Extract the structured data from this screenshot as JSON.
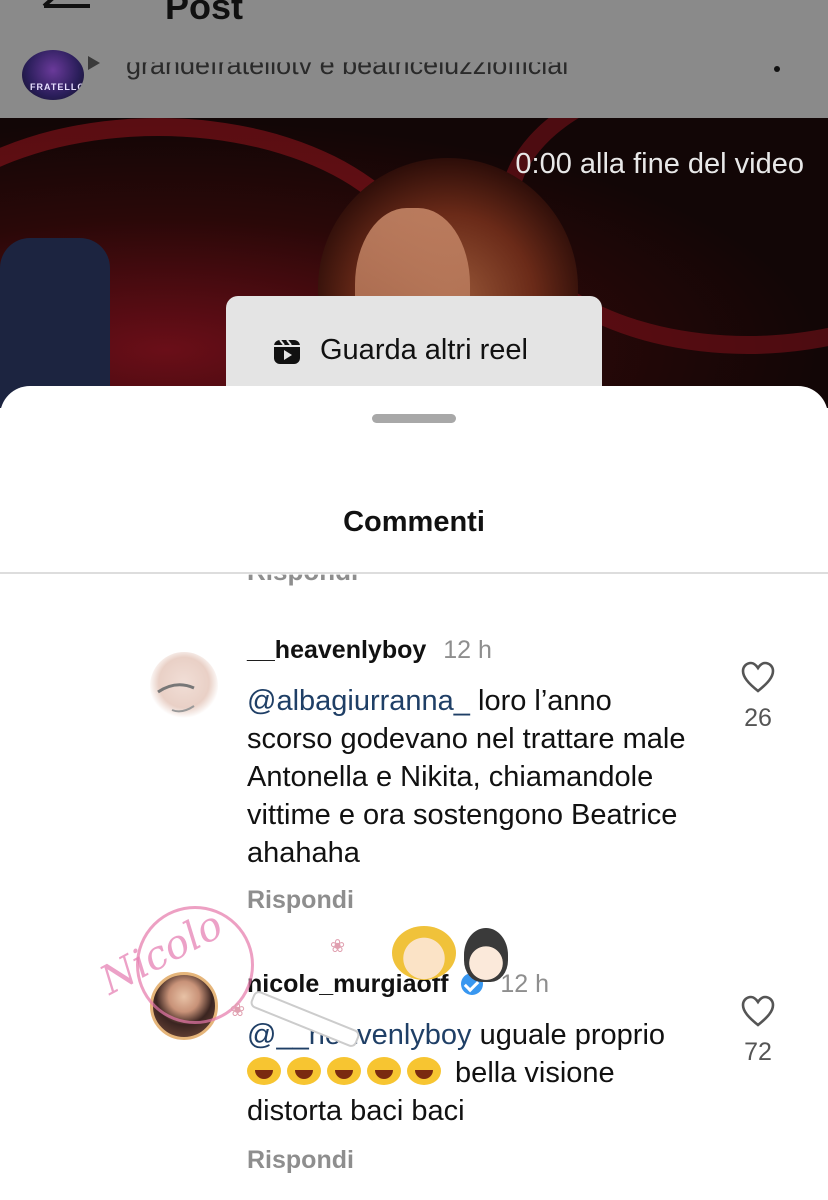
{
  "header": {
    "title": "Post",
    "author_line": "grandefratellotv e beatriceluzziofficial",
    "avatar_text": "FRATELLO"
  },
  "video": {
    "timer": "0:00 alla fine del video",
    "reels_button": "Guarda altri reel"
  },
  "sheet": {
    "title": "Commenti",
    "cut_reply": "Rispondi"
  },
  "comments": [
    {
      "username": "__heavenlyboy",
      "time": "12 h",
      "mention": "@albagiurranna_",
      "text": " loro l’anno scorso godevano nel trattare male Antonella e Nikita, chiamandole vittime e ora sostengono Beatrice ahahaha",
      "likes": "26",
      "reply": "Rispondi"
    },
    {
      "username": "nicole_murgiaoff",
      "time": "12 h",
      "mention": "@__heavenlyboy",
      "text_a": " uguale proprio ",
      "emoji_count": 5,
      "text_b": " bella visione distorta baci baci",
      "likes": "72",
      "reply": "Rispondi"
    }
  ],
  "watermark": {
    "signature": "Nicolo"
  },
  "icons": {
    "back": "back-arrow-icon",
    "more": "more-icon",
    "reels": "reels-icon",
    "like": "heart-icon",
    "verified": "verified-badge-icon"
  }
}
